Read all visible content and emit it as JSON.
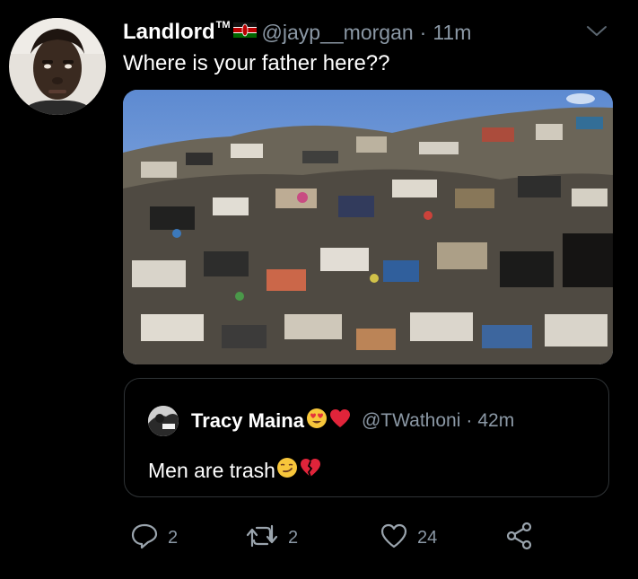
{
  "tweet": {
    "display_name": "Landlord",
    "trademark": "TM",
    "handle": "@jayp__morgan",
    "separator": "·",
    "time": "11m",
    "text": "Where is your father here??"
  },
  "quoted_tweet": {
    "display_name": "Tracy Maina",
    "handle": "@TWathoni",
    "separator": "·",
    "time": "42m",
    "text": "Men are trash"
  },
  "actions": {
    "reply_count": "2",
    "retweet_count": "2",
    "like_count": "24"
  },
  "colors": {
    "background": "#000000",
    "primary_text": "#ffffff",
    "secondary_text": "#8b98a5",
    "border": "#2f3336",
    "sky": "#6d96d6"
  },
  "icons": {
    "header_flag": "kenya-flag-icon",
    "more": "chevron-down-icon",
    "reply": "reply-icon",
    "retweet": "retweet-icon",
    "like": "heart-icon",
    "share": "share-icon",
    "quote_emojis": [
      "heart-eyes-emoji",
      "red-heart-emoji"
    ],
    "text_emojis": [
      "smirk-emoji",
      "broken-heart-emoji"
    ]
  }
}
